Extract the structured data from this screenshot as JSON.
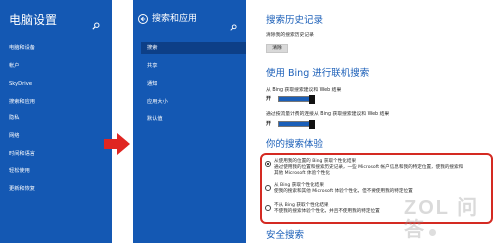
{
  "left_pane": {
    "title": "电脑设置",
    "items": [
      "电脑和设备",
      "帐户",
      "SkyDrive",
      "搜索和应用",
      "隐私",
      "网络",
      "时间和语言",
      "轻松使用",
      "更新和恢复"
    ]
  },
  "middle_pane": {
    "title": "搜索和应用",
    "items": [
      "搜索",
      "共享",
      "通知",
      "应用大小",
      "默认值"
    ],
    "selected_index": 0
  },
  "right_pane": {
    "history": {
      "title": "搜索历史记录",
      "label": "清除我的搜索历史记录",
      "button": "清除"
    },
    "bing": {
      "title": "使用 Bing 进行联机搜索",
      "toggle1_label": "从 Bing 获取搜索建议和 Web 结果",
      "toggle1_state": "开",
      "toggle2_label": "通过按流量计费的连接从 Bing 获取搜索建议和 Web 结果",
      "toggle2_state": "开"
    },
    "experience": {
      "title": "你的搜索体验",
      "options": [
        {
          "line1": "从使用我的位置的 Bing 获取个性化结果",
          "line2": "通过使用我的位置和搜索历史记录，一些 Microsoft 帐户信息和我的特定位置，使我的搜索和",
          "line3": "其他 Microsoft 体验个性化",
          "selected": true
        },
        {
          "line1": "从 Bing 获取个性化结果",
          "line2": "使我的搜索和其他 Microsoft 体验个性化，但不要使用我的特定位置",
          "selected": false
        },
        {
          "line1": "不从 Bing 获取个性化结果",
          "line2": "不使我的搜索体验个性化，并且不使用我的特定位置",
          "selected": false
        }
      ]
    },
    "safe_search": {
      "title": "安全搜索"
    }
  },
  "watermark": "ZOL 问答",
  "colors": {
    "sidebar_bg": "#1458b3",
    "selected_bg": "#0d3f87",
    "accent": "#1b5fb8",
    "highlight_border": "#d42a22",
    "arrow": "#e02622"
  },
  "icons": [
    "search-icon",
    "back-arrow-icon",
    "red-arrow-icon"
  ]
}
